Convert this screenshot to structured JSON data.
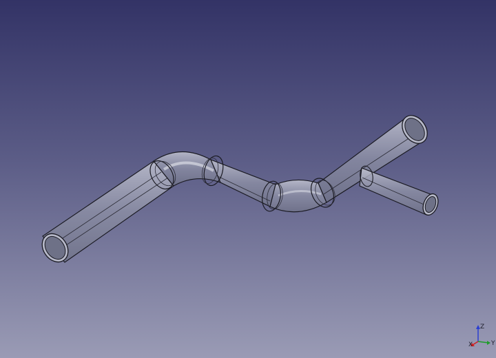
{
  "viewport": {
    "background_top": "#333366",
    "background_bottom": "#9a9bb5"
  },
  "model": {
    "pipe_fill": "#9b9eae",
    "pipe_edge": "#1a1a22",
    "pipe_rim": "#c9cad6"
  },
  "axes": {
    "x_label": "X",
    "y_label": "Y",
    "z_label": "Z",
    "x_color": "#d11f1f",
    "y_color": "#1f9c2a",
    "z_color": "#2b3fd1"
  }
}
